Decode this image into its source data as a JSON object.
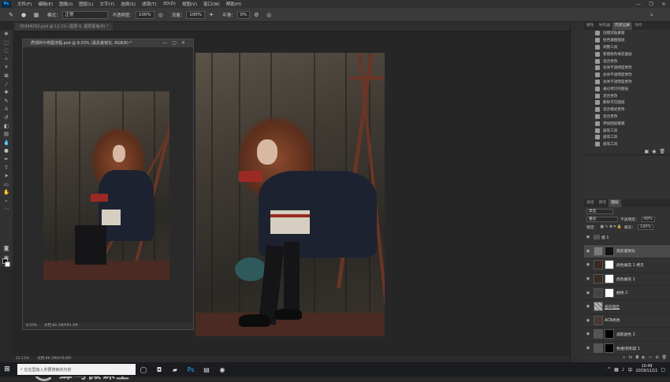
{
  "menubar": {
    "app_logo": "Ps",
    "items": [
      "文件(F)",
      "编辑(E)",
      "图像(I)",
      "图层(L)",
      "文字(Y)",
      "选择(S)",
      "滤镜(T)",
      "3D(D)",
      "视图(V)",
      "窗口(W)",
      "帮助(H)"
    ],
    "controls": [
      "—",
      "❐",
      "✕"
    ]
  },
  "options": {
    "mode_label": "模式：",
    "mode_value": "正常",
    "opacity_label": "不透明度：",
    "opacity_value": "100%",
    "flow_label": "流量：",
    "flow_value": "100%",
    "smooth_label": "平滑：",
    "smooth_value": "0%"
  },
  "document": {
    "tab_label": "05044292.psd @ 12.1% (图层 6, 图层蒙版/8) *",
    "float_title": "质感碎片修图流程.psd @ 8.03% (黑反差锐化, RGB/8) *",
    "float_zoom": "8.03%",
    "float_doc": "文档:86.1M/693.4M",
    "status_zoom": "12.11%",
    "status_doc": "文档:86.1M/678.6M"
  },
  "watermark": {
    "text": "蜂鸟微课堂"
  },
  "history": {
    "tabs": [
      "属性",
      "导航器",
      "历史记录",
      "动作"
    ],
    "active_tab": "历史记录",
    "items": [
      "创建剪贴蒙版",
      "拾色器图图层",
      "调整工具",
      "新建颜色填充图层",
      "混合更改",
      "总体不透明度更改",
      "总体不透明度更改",
      "总体不透明度更改",
      "通过拷贝的图层",
      "混合更改",
      "删除可见图层",
      "混合模式更改",
      "混合更改",
      "添加图层蒙版",
      "画笔工具",
      "画笔工具",
      "画笔工具"
    ]
  },
  "layers": {
    "tabs": [
      "通道",
      "路径",
      "图层"
    ],
    "active_tab": "图层",
    "filter_label": "类型",
    "blend_mode": "叠加",
    "opacity_label": "不透明度：",
    "opacity_value": "69%",
    "lock_label": "锁定：",
    "fill_label": "填充：",
    "fill_value": "100%",
    "items": [
      {
        "name": "组 1",
        "kind": "group"
      },
      {
        "name": "高反差锐化",
        "kind": "masked",
        "selected": true
      },
      {
        "name": "颜色填充 1 拷贝",
        "kind": "fill"
      },
      {
        "name": "颜色填充 1",
        "kind": "fill"
      },
      {
        "name": "曲线 2",
        "kind": "curves"
      },
      {
        "name": "盖印选区",
        "kind": "plain"
      },
      {
        "name": "ACR修改",
        "kind": "photo"
      },
      {
        "name": "选取颜色 2",
        "kind": "adjust"
      },
      {
        "name": "色相/饱和度 1",
        "kind": "adjust"
      }
    ]
  },
  "taskbar": {
    "search_placeholder": "在这里输入你要搜索的内容",
    "time": "10:49",
    "date": "2019/11/11"
  },
  "colors": {
    "accent": "#31a8ff",
    "panel": "#323232"
  }
}
